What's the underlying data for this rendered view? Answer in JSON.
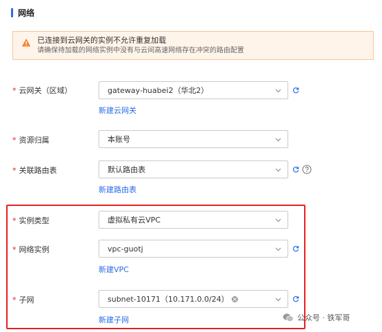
{
  "section": {
    "title": "网络"
  },
  "alert": {
    "title": "已连接到云网关的实例不允许重复加载",
    "desc": "请确保待加载的网络实例中没有与云间高速网络存在冲突的路由配置"
  },
  "fields": {
    "gateway": {
      "label": "云网关（区域）",
      "value": "gateway-huabei2（华北2）",
      "link": "新建云网关"
    },
    "owner": {
      "label": "资源归属",
      "value": "本账号"
    },
    "route_table": {
      "label": "关联路由表",
      "value": "默认路由表",
      "link": "新建路由表"
    },
    "instance_type": {
      "label": "实例类型",
      "value": "虚拟私有云VPC"
    },
    "network_instance": {
      "label": "网络实例",
      "value": "vpc-guotj",
      "link": "新建VPC"
    },
    "subnet": {
      "label": "子网",
      "tag": "subnet-10171（10.171.0.0/24）",
      "link": "新建子网"
    }
  },
  "brand": {
    "text": "公众号 · 铁军哥"
  },
  "colors": {
    "accent": "#2b6de5",
    "required": "#e02020",
    "highlight": "#e41f1f",
    "alert_bg": "#fff4ea"
  }
}
